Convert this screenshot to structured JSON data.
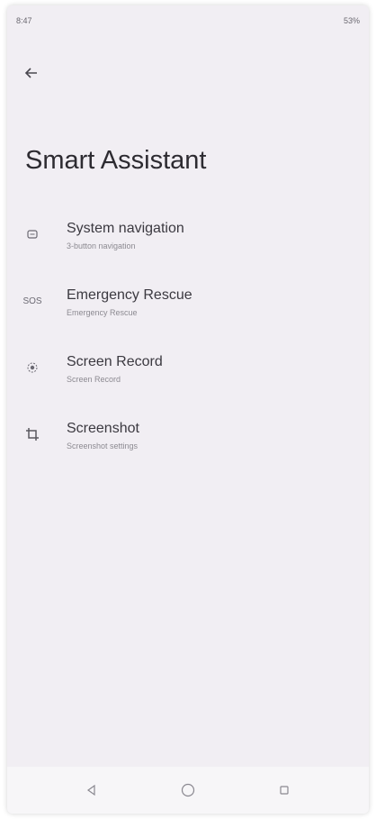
{
  "status_bar": {
    "time": "8:47",
    "battery": "53%"
  },
  "header": {
    "title": "Smart Assistant"
  },
  "items": [
    {
      "title": "System navigation",
      "subtitle": "3-button navigation",
      "icon": "navigation-icon"
    },
    {
      "title": "Emergency Rescue",
      "subtitle": "Emergency Rescue",
      "icon": "sos-icon"
    },
    {
      "title": "Screen Record",
      "subtitle": "Screen Record",
      "icon": "screen-record-icon"
    },
    {
      "title": "Screenshot",
      "subtitle": "Screenshot settings",
      "icon": "crop-icon"
    }
  ],
  "sos_label": "SOS",
  "colors": {
    "background": "#f1eef3",
    "text_primary": "#3b3940",
    "text_secondary": "#8c8a91"
  }
}
